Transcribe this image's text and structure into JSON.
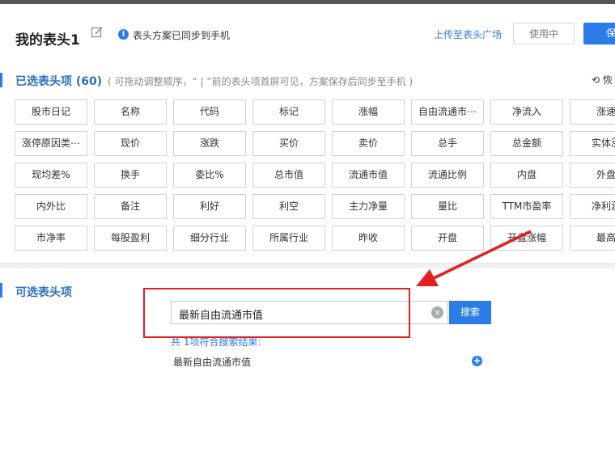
{
  "header": {
    "title": "我的表头1",
    "sync_status": "表头方案已同步到手机",
    "upload_link": "上传至表头广场",
    "in_use_label": "使用中",
    "save_label": "保"
  },
  "selected": {
    "title": "已选表头项 (60)",
    "hint": "( 可拖动调整顺序，“ | ”前的表头项首屏可见，方案保存后同步至手机 )",
    "restore_label": "恢",
    "rows": [
      [
        "股市日记",
        "名称",
        "代码",
        "标记",
        "涨幅",
        "自由流通市⋯",
        "净流入",
        "涨速"
      ],
      [
        "涨停原因类⋯",
        "现价",
        "涨跌",
        "买价",
        "卖价",
        "总手",
        "总金额",
        "实体涨"
      ],
      [
        "现均差%",
        "换手",
        "委比%",
        "总市值",
        "流通市值",
        "流通比例",
        "内盘",
        "外盘"
      ],
      [
        "内外比",
        "备注",
        "利好",
        "利空",
        "主力净量",
        "量比",
        "TTM市盈率",
        "净利润"
      ],
      [
        "市净率",
        "每股盈利",
        "细分行业",
        "所属行业",
        "昨收",
        "开盘",
        "开盘涨幅",
        "最高"
      ]
    ]
  },
  "optional": {
    "title": "可选表头项",
    "search_value": "最新自由流通市值",
    "search_button": "搜索",
    "result_count": "共 1项符合搜索结果:",
    "results": [
      "最新自由流通市值"
    ]
  },
  "colors": {
    "accent": "#2b7ce9",
    "annotation": "#e32020"
  }
}
